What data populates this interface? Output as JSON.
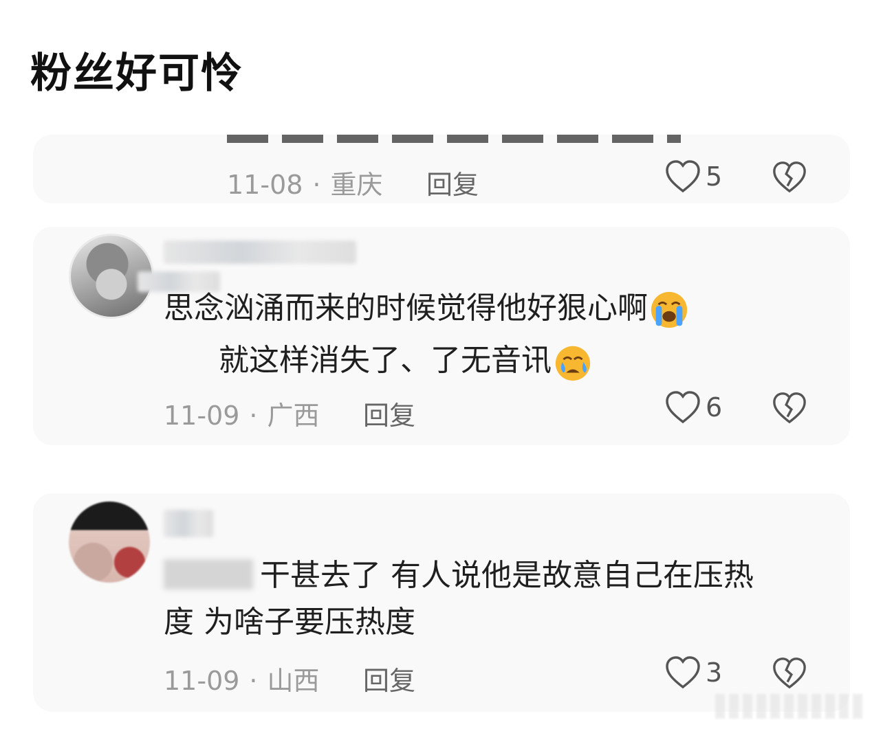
{
  "post": {
    "title": "粉丝好可怜"
  },
  "comments": [
    {
      "date": "11-08",
      "location": "重庆",
      "reply_label": "回复",
      "likes": "5"
    },
    {
      "text_line1": "思念汹涌而来的时候觉得他好狠心啊",
      "text_line2": "就这样消失了、了无音讯",
      "date": "11-09",
      "location": "广西",
      "reply_label": "回复",
      "likes": "6"
    },
    {
      "text_line1": "干甚去了  有人说他是故意自己在压热",
      "text_line2": "度  为啥子要压热度",
      "date": "11-09",
      "location": "山西",
      "reply_label": "回复",
      "likes": "3"
    }
  ],
  "icons": {
    "like": "heart-outline-icon",
    "dislike": "broken-heart-icon",
    "emoji_cry": "loudly-crying-face-emoji",
    "emoji_sad": "crying-face-emoji"
  },
  "colors": {
    "meta_gray": "#9a9a9a",
    "card_bg": "#f9f9f9",
    "emoji_yellow": "#f7b731",
    "tear_blue": "#4aa3ff"
  }
}
